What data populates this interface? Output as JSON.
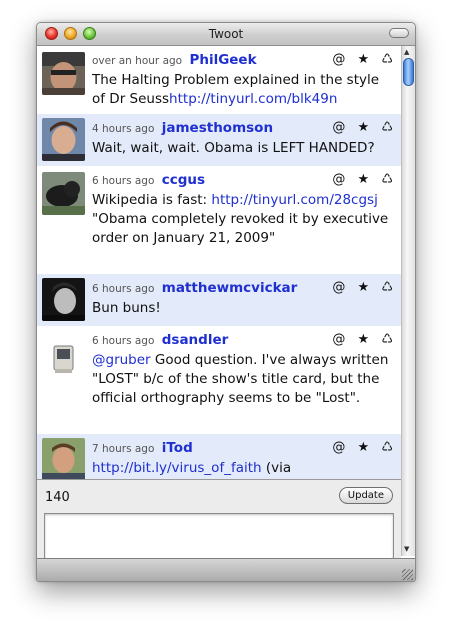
{
  "window": {
    "title": "Twoot"
  },
  "timeline": {
    "tweets": [
      {
        "time": "over an hour ago",
        "user": "PhilGeek",
        "text_plain": "The Halting Problem explained in the style of Dr Seuss",
        "link": "http://tinyurl.com/blk49n",
        "text_after": ""
      },
      {
        "time": "4 hours ago",
        "user": "jamesthomson",
        "text_plain": "Wait, wait, wait. Obama is LEFT HANDED?",
        "link": "",
        "text_after": ""
      },
      {
        "time": "6 hours ago",
        "user": "ccgus",
        "text_plain": "Wikipedia is fast:",
        "link": "http://tinyurl.com/28cgsj",
        "text_after": " \"Obama completely revoked it by executive order on January 21, 2009\""
      },
      {
        "time": "6 hours ago",
        "user": "matthewmcvickar",
        "text_plain": "Bun buns!",
        "link": "",
        "text_after": ""
      },
      {
        "time": "6 hours ago",
        "user": "dsandler",
        "mention": "@gruber",
        "text_plain": " Good question. I've always written \"LOST\" b/c of the show's title card, but the official orthography seems to be \"Lost\".",
        "link": "",
        "text_after": ""
      },
      {
        "time": "7 hours ago",
        "user": "iTod",
        "text_plain": "",
        "link": "http://bit.ly/virus_of_faith",
        "text_after": " (via"
      }
    ],
    "actions": {
      "reply": "@",
      "favorite": "★",
      "retweet": "♺"
    }
  },
  "composer": {
    "char_count": "140",
    "update_label": "Update",
    "input_value": ""
  },
  "colors": {
    "link": "#1f2fd0",
    "alt_row": "#e3ebfa"
  }
}
